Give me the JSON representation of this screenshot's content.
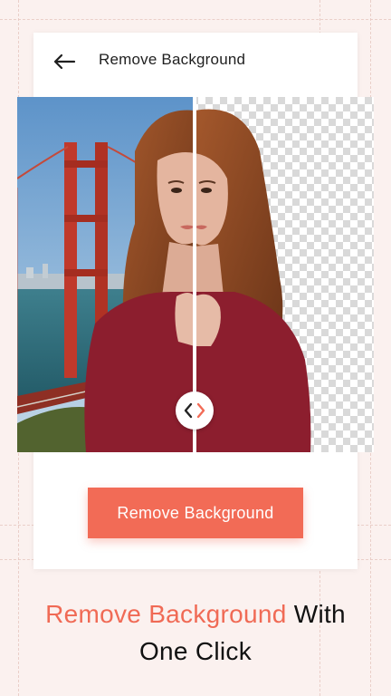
{
  "header": {
    "title": "Remove Background",
    "back_icon": "arrow-left-icon"
  },
  "preview": {
    "handle_icons": [
      "chevron-left-icon",
      "chevron-right-icon"
    ],
    "handle_colors": {
      "left": "#222222",
      "right": "#f26b56"
    },
    "transparent_pattern_colors": [
      "#ffffff",
      "#d9d9d9"
    ]
  },
  "cta": {
    "label": "Remove Background",
    "color": "#f26b56"
  },
  "caption": {
    "highlight": "Remove Background",
    "rest_line1": " With",
    "line2": "One Click",
    "highlight_color": "#f06a55"
  },
  "theme": {
    "background": "#fbf1ef",
    "card": "#ffffff"
  }
}
